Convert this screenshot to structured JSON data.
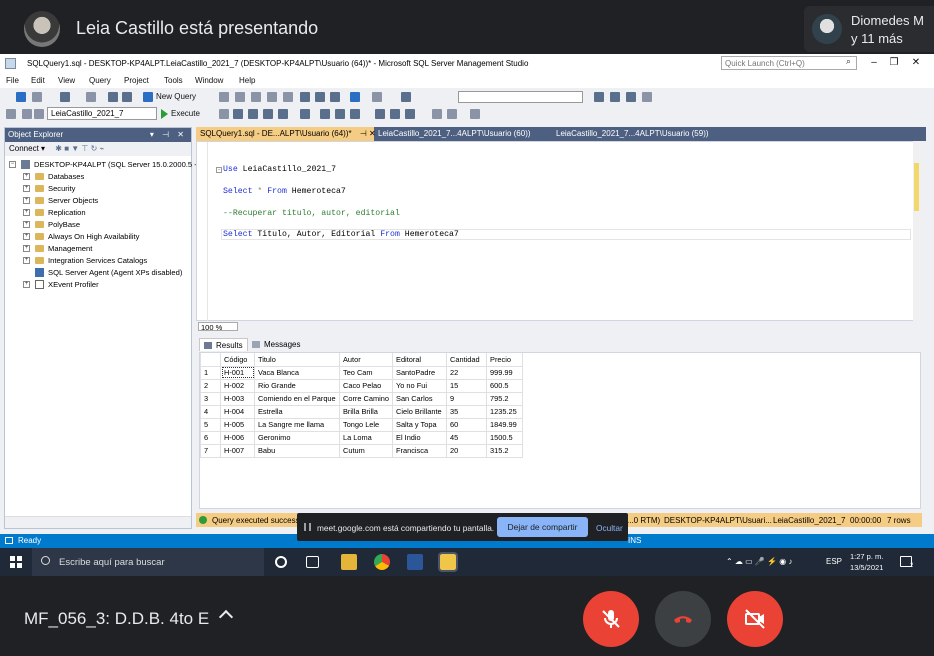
{
  "meet": {
    "presenter_title": "Leia Castillo está presentando",
    "participants_name": "Diomedes M",
    "participants_more": "y 11 más",
    "meeting_title": "MF_056_3: D.D.B. 4to E",
    "share_banner_text": "meet.google.com está compartiendo tu pantalla.",
    "share_stop_label": "Dejar de compartir",
    "share_hide_label": "Ocultar",
    "colors": {
      "danger": "#ea4335",
      "accent": "#8ab4f8",
      "background": "#202124"
    }
  },
  "ssms": {
    "window_title": "SQLQuery1.sql - DESKTOP-KP4ALPT.LeiaCastillo_2021_7 (DESKTOP-KP4ALPT\\Usuario (64))* - Microsoft SQL Server Management Studio",
    "quick_launch_placeholder": "Quick Launch (Ctrl+Q)",
    "menu": [
      "File",
      "Edit",
      "View",
      "Query",
      "Project",
      "Tools",
      "Window",
      "Help"
    ],
    "toolbar": {
      "new_query_label": "New Query",
      "database_selected": "LeiaCastillo_2021_7",
      "execute_label": "Execute"
    },
    "object_explorer": {
      "title": "Object Explorer",
      "connect_label": "Connect ▾",
      "server": "DESKTOP-KP4ALPT (SQL Server 15.0.2000.5 -",
      "nodes": [
        "Databases",
        "Security",
        "Server Objects",
        "Replication",
        "PolyBase",
        "Always On High Availability",
        "Management",
        "Integration Services Catalogs",
        "SQL Server Agent (Agent XPs disabled)",
        "XEvent Profiler"
      ]
    },
    "tabs": [
      "SQLQuery1.sql - DE...ALPT\\Usuario (64))*",
      "LeiaCastillo_2021_7...4ALPT\\Usuario (60))",
      "LeiaCastillo_2021_7...4ALPT\\Usuario (59))"
    ],
    "code": {
      "line1_kw": "Use",
      "line1_rest": " LeiaCastillo_2021_7",
      "line2_kw1": "Select",
      "line2_star": " * ",
      "line2_kw2": "From",
      "line2_rest": " Hemeroteca7",
      "line3_comment": "--Recuperar titulo, autor, editorial",
      "line4_kw1": "Select",
      "line4_cols": " Titulo, Autor, Editorial ",
      "line4_kw2": "From",
      "line4_rest": " Hemeroteca7"
    },
    "zoom": "100 %",
    "results_tab": "Results",
    "messages_tab": "Messages",
    "grid": {
      "columns": [
        "Código",
        "Titulo",
        "Autor",
        "Editoral",
        "Cantidad",
        "Precio"
      ],
      "rows": [
        [
          "1",
          "H-001",
          "Vaca Blanca",
          "Teo Cam",
          "SantoPadre",
          "22",
          "999.99"
        ],
        [
          "2",
          "H-002",
          "Rio Grande",
          "Caco Pelao",
          "Yo no Fui",
          "15",
          "600.5"
        ],
        [
          "3",
          "H-003",
          "Comiendo en el Parque",
          "Corre Camino",
          "San Carlos",
          "9",
          "795.2"
        ],
        [
          "4",
          "H-004",
          "Estrella",
          "Brilla Brilla",
          "Cielo Brillante",
          "35",
          "1235.25"
        ],
        [
          "5",
          "H-005",
          "La Sangre me llama",
          "Tongo Lele",
          "Salta y Topa",
          "60",
          "1849.99"
        ],
        [
          "6",
          "H-006",
          "Geronimo",
          "La Loma",
          "El Indio",
          "45",
          "1500.5"
        ],
        [
          "7",
          "H-007",
          "Babu",
          "Cutum",
          "Francisca",
          "20",
          "315.2"
        ]
      ]
    },
    "query_status": {
      "message": "Query executed successfully.",
      "right_rtm": "...0 RTM)",
      "server": "DESKTOP-KP4ALPT\\Usuari...",
      "database": "LeiaCastillo_2021_7",
      "time": "00:00:00",
      "rows": "7 rows"
    },
    "status_ready": "Ready",
    "status_ins": "INS",
    "colors": {
      "accent": "#007acc",
      "tab_active": "#f5cc84",
      "header": "#4d6082"
    }
  },
  "taskbar": {
    "search_placeholder": "Escribe aquí para buscar",
    "lang": "ESP",
    "time": "1:27 p. m.",
    "date": "13/5/2021",
    "notification_count": "2"
  }
}
